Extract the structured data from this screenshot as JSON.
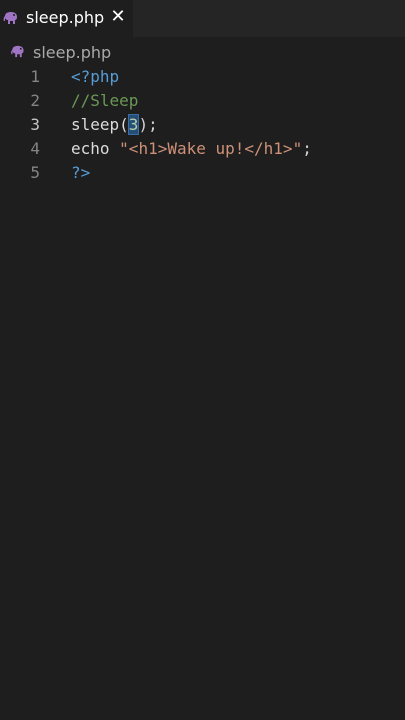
{
  "tab": {
    "label": "sleep.php",
    "close_glyph": "✕",
    "icon": "php-elephant-icon"
  },
  "breadcrumb": {
    "label": "sleep.php",
    "icon": "php-elephant-icon"
  },
  "colors": {
    "editor_bg": "#1e1e1e",
    "tabbar_bg": "#252526",
    "php_icon": "#a074c4",
    "tag": "#569cd6",
    "comment": "#6a9955",
    "string": "#ce9178",
    "number": "#b5cea8"
  },
  "editor": {
    "active_line": 3,
    "lines": [
      {
        "number": "1",
        "tokens": [
          {
            "text": "<?php",
            "kind": "tag"
          }
        ]
      },
      {
        "number": "2",
        "tokens": [
          {
            "text": "//Sleep",
            "kind": "comment"
          }
        ]
      },
      {
        "number": "3",
        "tokens": [
          {
            "text": "sleep(",
            "kind": "fn"
          },
          {
            "text": "3",
            "kind": "num"
          },
          {
            "text": ");",
            "kind": "punct"
          }
        ]
      },
      {
        "number": "4",
        "tokens": [
          {
            "text": "echo ",
            "kind": "fn"
          },
          {
            "text": "\"<h1>Wake up!</h1>\"",
            "kind": "str"
          },
          {
            "text": ";",
            "kind": "punct"
          }
        ]
      },
      {
        "number": "5",
        "tokens": [
          {
            "text": "?>",
            "kind": "tag"
          }
        ]
      }
    ]
  }
}
